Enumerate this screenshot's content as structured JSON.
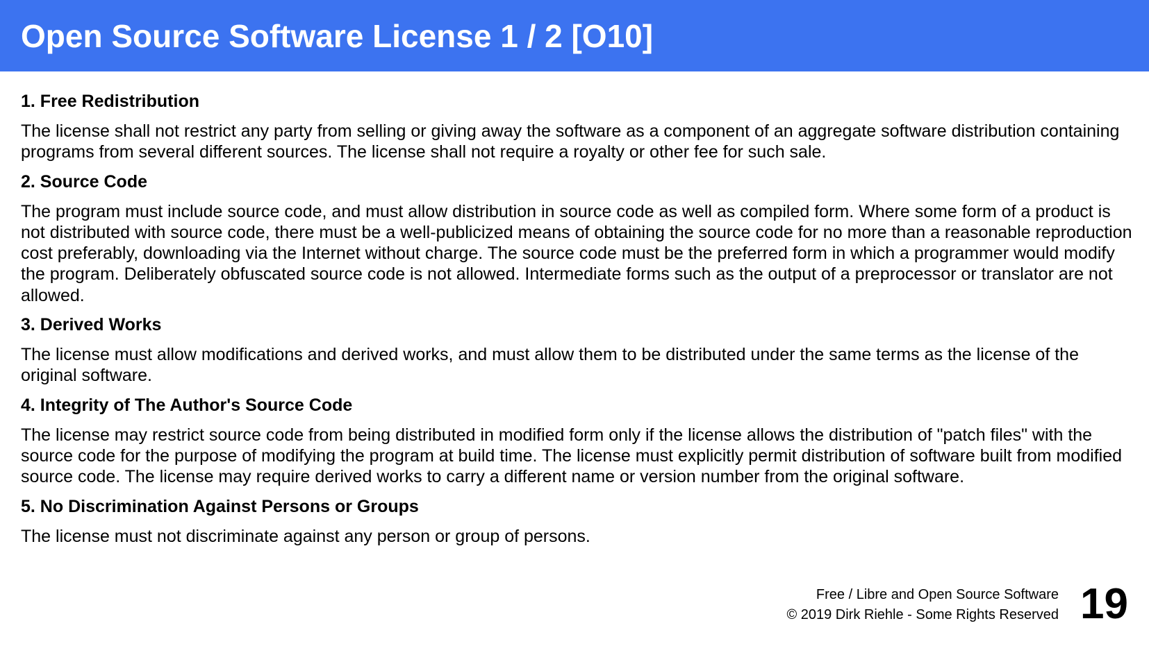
{
  "title": "Open Source Software License 1 / 2 [O10]",
  "sections": [
    {
      "heading": "1. Free Redistribution",
      "body": "The license shall not restrict any party from selling or giving away the software as a component of an aggregate software distribution containing programs from several different sources. The license shall not require a royalty or other fee for such sale."
    },
    {
      "heading": "2. Source Code",
      "body": "The program must include source code, and must allow distribution in source code as well as compiled form. Where some form of a product is not distributed with source code, there must be a well-publicized means of obtaining the source code for no more than a reasonable reproduction cost preferably, downloading via the Internet without charge. The source code must be the preferred form in which a programmer would modify the program. Deliberately obfuscated source code is not allowed. Intermediate forms such as the output of a preprocessor or translator are not allowed."
    },
    {
      "heading": "3. Derived Works",
      "body": "The license must allow modifications and derived works, and must allow them to be distributed under the same terms as the license of the original software."
    },
    {
      "heading": "4. Integrity of The Author's Source Code",
      "body": "The license may restrict source code from being distributed in modified form only if the license allows the distribution of \"patch files\" with the source code for the purpose of modifying the program at build time. The license must explicitly permit distribution of software built from modified source code. The license may require derived works to carry a different name or version number from the original software."
    },
    {
      "heading": "5. No Discrimination Against Persons or Groups",
      "body": "The license must not discriminate against any person or group of persons."
    }
  ],
  "footer": {
    "line1": "Free / Libre and Open Source Software",
    "line2": "© 2019 Dirk Riehle - Some Rights Reserved",
    "page_number": "19"
  },
  "colors": {
    "title_bar": "#3c73f0",
    "title_text": "#ffffff",
    "body_text": "#000000"
  }
}
